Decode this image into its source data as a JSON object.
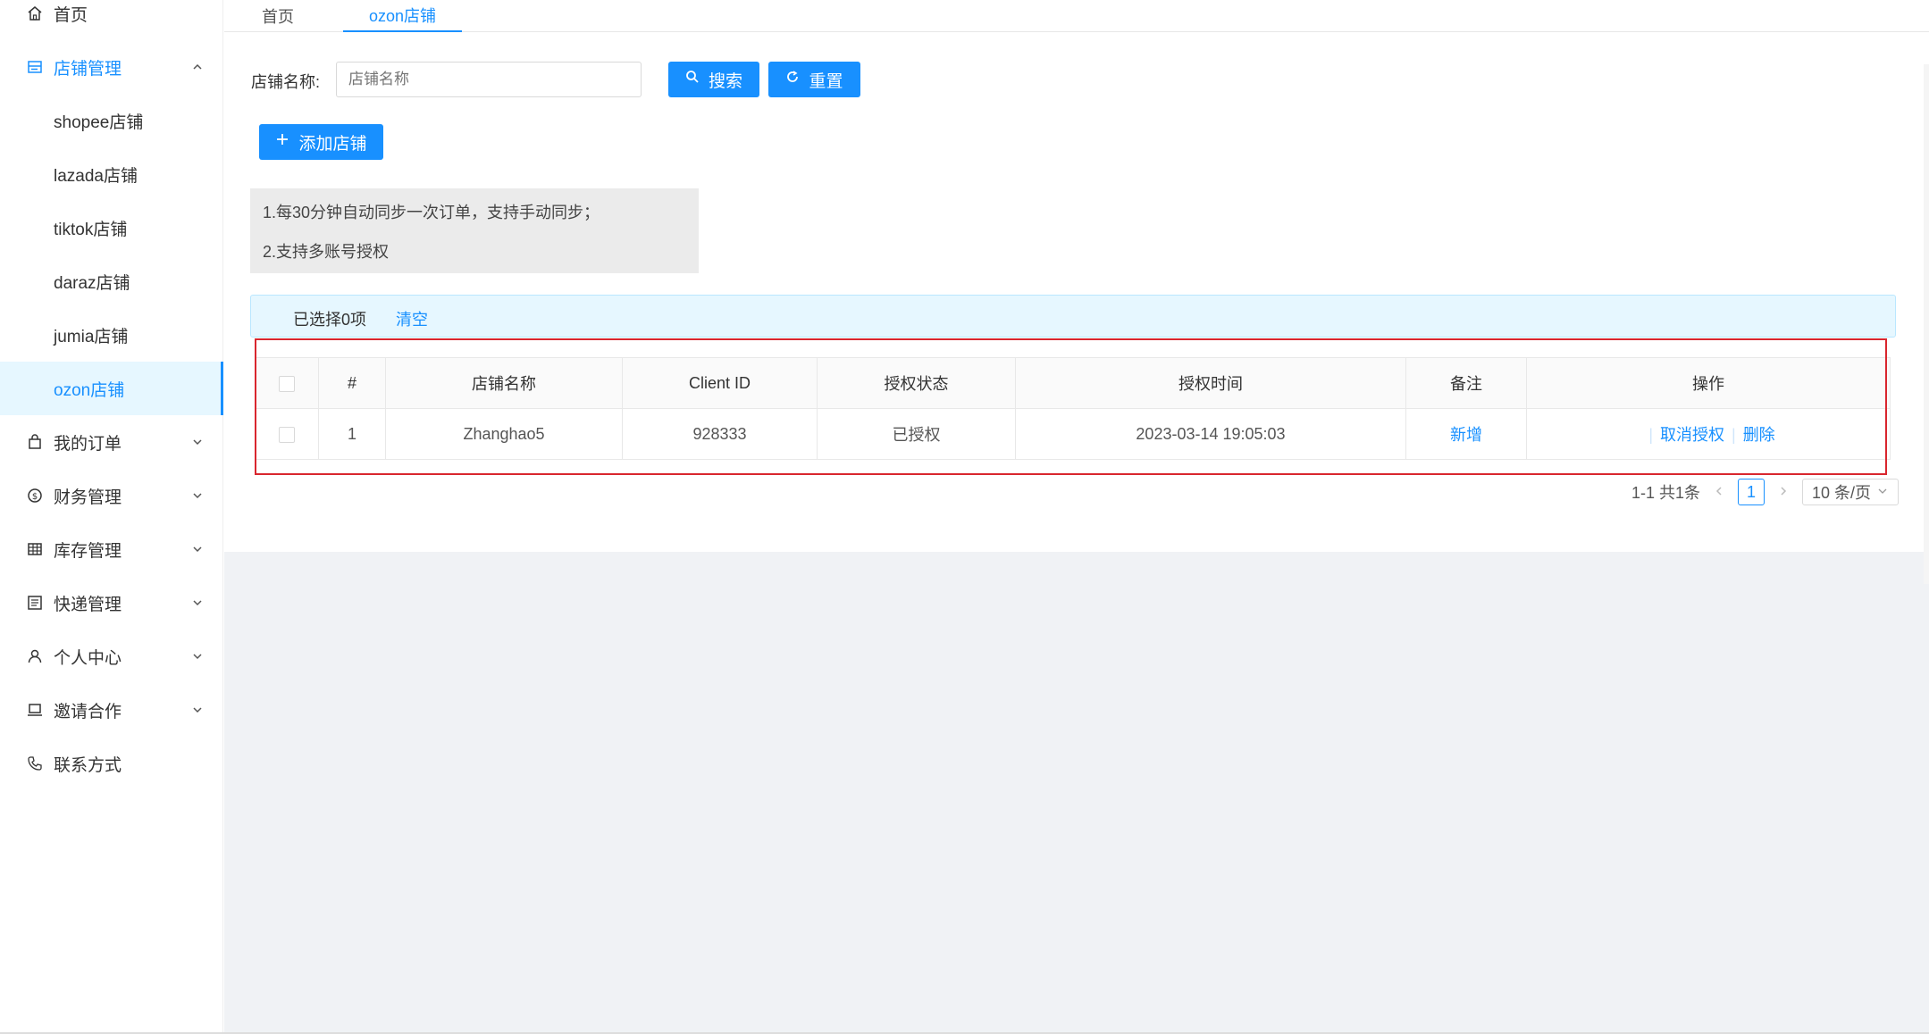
{
  "sidebar": {
    "home": "首页",
    "store_mgmt": "店铺管理",
    "stores": [
      "shopee店铺",
      "lazada店铺",
      "tiktok店铺",
      "daraz店铺",
      "jumia店铺",
      "ozon店铺"
    ],
    "my_orders": "我的订单",
    "finance": "财务管理",
    "inventory": "库存管理",
    "express": "快递管理",
    "profile": "个人中心",
    "invite": "邀请合作",
    "contact": "联系方式"
  },
  "tabs": [
    "首页",
    "ozon店铺"
  ],
  "search": {
    "label": "店铺名称:",
    "placeholder": "店铺名称",
    "search_btn": "搜索",
    "reset_btn": "重置"
  },
  "add_btn": "添加店铺",
  "notice": [
    "1.每30分钟自动同步一次订单，支持手动同步；",
    "2.支持多账号授权"
  ],
  "selection": {
    "text": "已选择0项",
    "clear": "清空"
  },
  "table": {
    "headers": [
      "#",
      "店铺名称",
      "Client ID",
      "授权状态",
      "授权时间",
      "备注",
      "操作"
    ],
    "rows": [
      {
        "index": "1",
        "name": "Zhanghao5",
        "client_id": "928333",
        "status": "已授权",
        "time": "2023-03-14 19:05:03",
        "remark": "新增",
        "op_cancel": "取消授权",
        "op_delete": "删除"
      }
    ]
  },
  "pagination": {
    "summary": "1-1 共1条",
    "current": "1",
    "size": "10 条/页"
  },
  "colors": {
    "primary": "#1890ff",
    "highlight": "#d9262e",
    "selbar": "#e6f7ff"
  }
}
